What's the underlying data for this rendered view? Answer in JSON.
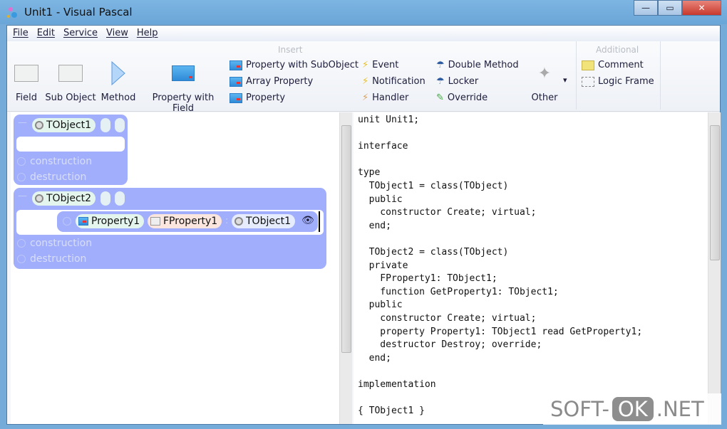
{
  "window": {
    "title": "Unit1 - Visual Pascal",
    "min": "—",
    "max": "▭",
    "close": "✕"
  },
  "menu": [
    "File",
    "Edit",
    "Service",
    "View",
    "Help"
  ],
  "ribbon": {
    "insert_label": "Insert",
    "additional_label": "Additional",
    "big": [
      "Field",
      "Sub Object",
      "Method",
      "Property with Field"
    ],
    "col1": [
      "Property with SubObject",
      "Array Property",
      "Property"
    ],
    "col2": [
      "Event",
      "Notification",
      "Handler"
    ],
    "col3": [
      "Double Method",
      "Locker",
      "Override"
    ],
    "other": "Other",
    "other_arrow": "▾",
    "additional": [
      "Comment",
      "Logic Frame"
    ]
  },
  "designer": {
    "class1": {
      "name": "TObject1",
      "construction": "construction",
      "destruction": "destruction"
    },
    "class2": {
      "name": "TObject2",
      "property": "Property1",
      "field": "FProperty1",
      "sep": ":",
      "type": "TObject1",
      "construction": "construction",
      "destruction": "destruction"
    }
  },
  "code": [
    "unit Unit1;",
    "",
    "interface",
    "",
    "type",
    "  TObject1 = class(TObject)",
    "  public",
    "    constructor Create; virtual;",
    "  end;",
    "",
    "  TObject2 = class(TObject)",
    "  private",
    "    FProperty1: TObject1;",
    "    function GetProperty1: TObject1;",
    "  public",
    "    constructor Create; virtual;",
    "    property Property1: TObject1 read GetProperty1;",
    "    destructor Destroy; override;",
    "  end;",
    "",
    "implementation",
    "",
    "{ TObject1 }"
  ],
  "watermark": {
    "a": "SOFT-",
    "b": "OK",
    ".c": ".NET",
    "c": ".NET"
  }
}
